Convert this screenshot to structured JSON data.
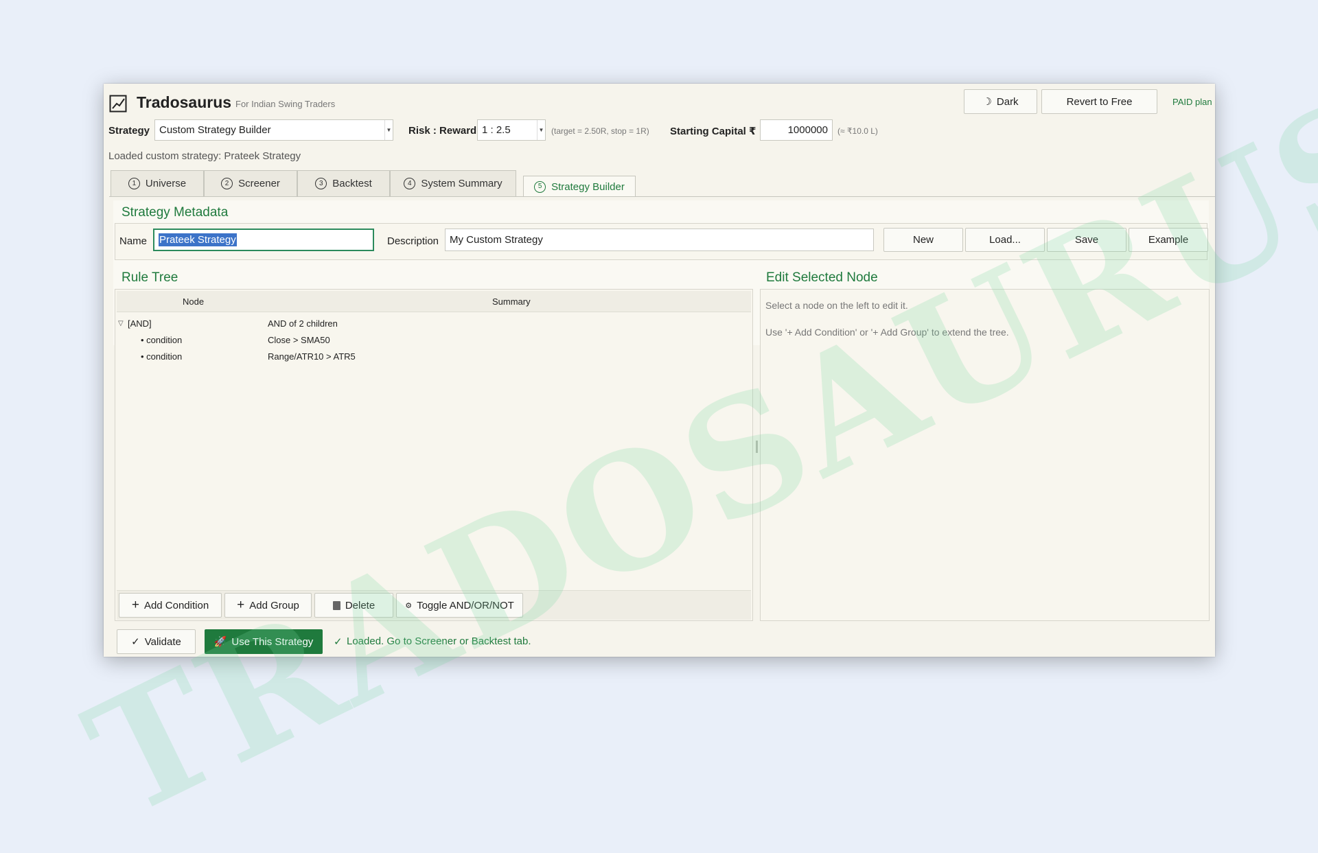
{
  "app": {
    "title": "Tradosaurus",
    "subtitle": "For Indian Swing Traders",
    "theme_button": "Dark",
    "revert_button": "Revert to Free",
    "plan": "PAID plan",
    "watermark": "TRADOSAURUS"
  },
  "settings": {
    "strategy_label": "Strategy",
    "strategy_value": "Custom Strategy Builder",
    "rr_label": "Risk : Reward",
    "rr_value": "1 : 2.5",
    "rr_note": "(target = 2.50R, stop = 1R)",
    "capital_label": "Starting Capital ₹",
    "capital_value": "1000000",
    "capital_note": "(≈ ₹10.0 L)"
  },
  "status_line": "Loaded custom strategy: Prateek Strategy",
  "tabs": [
    {
      "num": "1",
      "label": "Universe"
    },
    {
      "num": "2",
      "label": "Screener"
    },
    {
      "num": "3",
      "label": "Backtest"
    },
    {
      "num": "4",
      "label": "System Summary"
    },
    {
      "num": "5",
      "label": "Strategy Builder"
    }
  ],
  "metadata": {
    "title": "Strategy Metadata",
    "name_label": "Name",
    "name_value": "Prateek Strategy",
    "description_label": "Description",
    "description_value": "My Custom Strategy",
    "buttons": {
      "new": "New",
      "load": "Load...",
      "save": "Save",
      "example": "Example"
    }
  },
  "rule_tree": {
    "title": "Rule Tree",
    "columns": {
      "node": "Node",
      "summary": "Summary"
    },
    "rows": [
      {
        "node": "[AND]",
        "summary": "AND of 2 children"
      },
      {
        "node": "• condition",
        "summary": "Close  >  SMA50"
      },
      {
        "node": "• condition",
        "summary": "Range/ATR10  >  ATR5"
      }
    ],
    "buttons": {
      "add_condition": "Add Condition",
      "add_group": "Add Group",
      "delete": "Delete",
      "toggle": "Toggle AND/OR/NOT"
    }
  },
  "edit_node": {
    "title": "Edit Selected Node",
    "hint1": "Select a node on the left to edit it.",
    "hint2": "Use '+ Add Condition' or '+ Add Group' to extend the tree."
  },
  "footer": {
    "validate": "Validate",
    "use_strategy": "Use This Strategy",
    "message": "Loaded. Go to Screener or Backtest tab."
  },
  "colors": {
    "accent": "#1f7a3d",
    "background": "#e9eff9",
    "window": "#f6f4ec"
  }
}
